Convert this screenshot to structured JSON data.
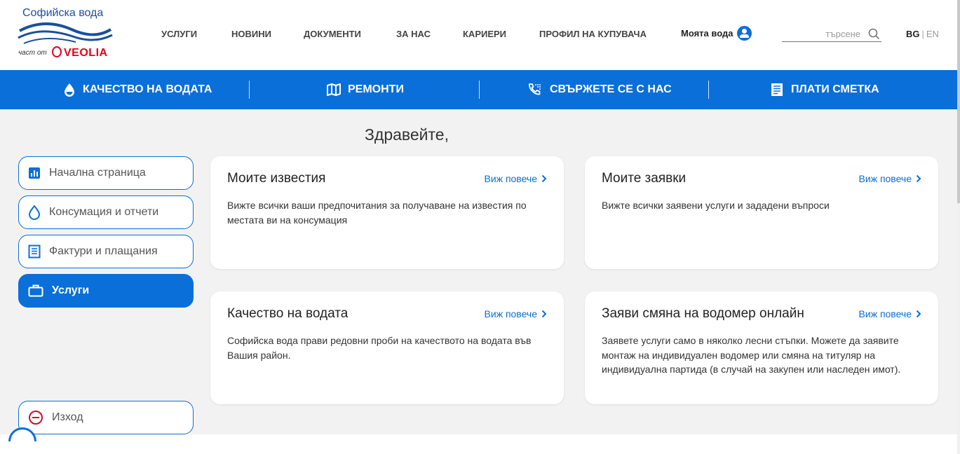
{
  "brand": {
    "title": "Софийска вода",
    "sub": "част от",
    "partner": "VEOLIA"
  },
  "nav": {
    "items": [
      "УСЛУГИ",
      "НОВИНИ",
      "ДОКУМЕНТИ",
      "ЗА НАС",
      "КАРИЕРИ",
      "ПРОФИЛ НА КУПУВАЧА"
    ],
    "my_water": "Моята вода",
    "search_placeholder": "търсене",
    "lang_active": "BG",
    "lang_sep": "|",
    "lang_other": "EN"
  },
  "quickbar": {
    "items": [
      {
        "label": "КАЧЕСТВО НА ВОДАТА",
        "icon": "water-drop-icon"
      },
      {
        "label": "РЕМОНТИ",
        "icon": "map-icon"
      },
      {
        "label": "СВЪРЖЕТЕ СЕ С НАС",
        "icon": "phone-icon"
      },
      {
        "label": "ПЛАТИ СМЕТКА",
        "icon": "receipt-icon"
      }
    ]
  },
  "greeting": "Здравейте,",
  "sidebar": {
    "items": [
      {
        "label": "Начална страница",
        "icon": "chart-icon",
        "active": false
      },
      {
        "label": "Консумация и отчети",
        "icon": "water-drop-icon",
        "active": false
      },
      {
        "label": "Фактури и плащания",
        "icon": "invoice-icon",
        "active": false
      },
      {
        "label": "Услуги",
        "icon": "briefcase-icon",
        "active": true
      }
    ],
    "exit": {
      "label": "Изход",
      "icon": "exit-icon"
    }
  },
  "cards": [
    {
      "title": "Моите известия",
      "more": "Виж повече",
      "text": "Вижте всички ваши предпочитания за получаване на известия по местата ви на консумация"
    },
    {
      "title": "Моите заявки",
      "more": "Виж повече",
      "text": "Вижте всички заявени услуги и зададени въпроси"
    },
    {
      "title": "Качество на водата",
      "more": "Виж повече",
      "text": "Софийска вода прави редовни проби на качеството на водата във Вашия район."
    },
    {
      "title": "Заяви смяна на водомер онлайн",
      "more": "Виж повече",
      "text": "Заявете услуги само в няколко лесни стъпки. Можете да заявите монтаж на индивидуален водомер или смяна на титуляр на индивидуална партида (в случай на закупен или наследен имот)."
    }
  ],
  "colors": {
    "primary": "#0a6fd8",
    "brand_red": "#e2001a",
    "background": "#f2f2f3"
  }
}
